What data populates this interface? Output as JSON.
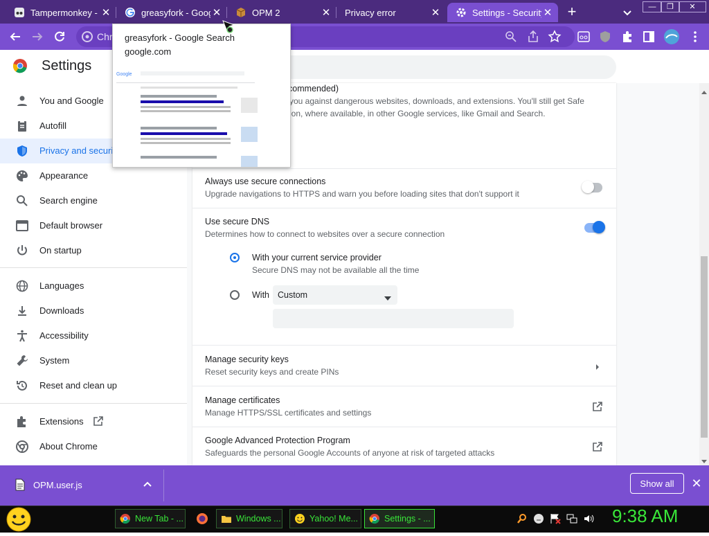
{
  "browser": {
    "tabs": [
      {
        "title": "Tampermonkey - Ch",
        "favicon": "tampermonkey-icon",
        "active": false
      },
      {
        "title": "greasyfork - Google Search",
        "favicon": "google-icon",
        "active": false
      },
      {
        "title": "OPM 2",
        "favicon": "package-icon",
        "active": false
      },
      {
        "title": "Privacy error",
        "favicon": "",
        "active": false
      },
      {
        "title": "Settings - Security",
        "favicon": "gear-icon",
        "active": true
      }
    ],
    "omnibox_text": "Chr",
    "hovercard": {
      "title": "greasyfork - Google Search",
      "domain": "google.com"
    }
  },
  "settings": {
    "title": "Settings",
    "sidebar": {
      "items": [
        {
          "label": "You and Google",
          "icon": "person-icon"
        },
        {
          "label": "Autofill",
          "icon": "clipboard-icon"
        },
        {
          "label": "Privacy and security",
          "icon": "shield-icon",
          "selected": true
        },
        {
          "label": "Appearance",
          "icon": "palette-icon"
        },
        {
          "label": "Search engine",
          "icon": "search-icon"
        },
        {
          "label": "Default browser",
          "icon": "browser-window-icon"
        },
        {
          "label": "On startup",
          "icon": "power-icon"
        },
        {
          "label": "Languages",
          "icon": "globe-icon"
        },
        {
          "label": "Downloads",
          "icon": "download-icon"
        },
        {
          "label": "Accessibility",
          "icon": "accessibility-icon"
        },
        {
          "label": "System",
          "icon": "wrench-icon"
        },
        {
          "label": "Reset and clean up",
          "icon": "history-icon"
        },
        {
          "label": "Extensions",
          "icon": "puzzle-icon"
        },
        {
          "label": "About Chrome",
          "icon": "chrome-icon"
        }
      ]
    },
    "content": {
      "no_protection_tail": "t recommended)",
      "no_protection_desc1": "you against dangerous websites, downloads, and extensions. You'll still get Safe",
      "no_protection_desc2": "ion, where available, in other Google services, like Gmail and Search.",
      "https": {
        "title": "Always use secure connections",
        "desc": "Upgrade navigations to HTTPS and warn you before loading sites that don't support it",
        "enabled": false
      },
      "dns": {
        "title": "Use secure DNS",
        "desc": "Determines how to connect to websites over a secure connection",
        "enabled": true,
        "opt_current_title": "With your current service provider",
        "opt_current_desc": "Secure DNS may not be available all the time",
        "opt_with_label": "With",
        "custom_value": "Custom"
      },
      "security_keys": {
        "title": "Manage security keys",
        "desc": "Reset security keys and create PINs"
      },
      "certificates": {
        "title": "Manage certificates",
        "desc": "Manage HTTPS/SSL certificates and settings"
      },
      "advanced_protection": {
        "title": "Google Advanced Protection Program",
        "desc": "Safeguards the personal Google Accounts of anyone at risk of targeted attacks"
      }
    }
  },
  "download_bar": {
    "file": "OPM.user.js",
    "show_all": "Show all"
  },
  "taskbar": {
    "items": [
      "New Tab - ...",
      "Windows ...",
      "Yahoo! Me...",
      "Settings - ..."
    ],
    "clock": "9:38 AM"
  },
  "colors": {
    "tabstrip": "#4b2b7e",
    "toolbar": "#7a4fd1",
    "accent": "#1a73e8",
    "taskbar_text": "#39e639"
  }
}
